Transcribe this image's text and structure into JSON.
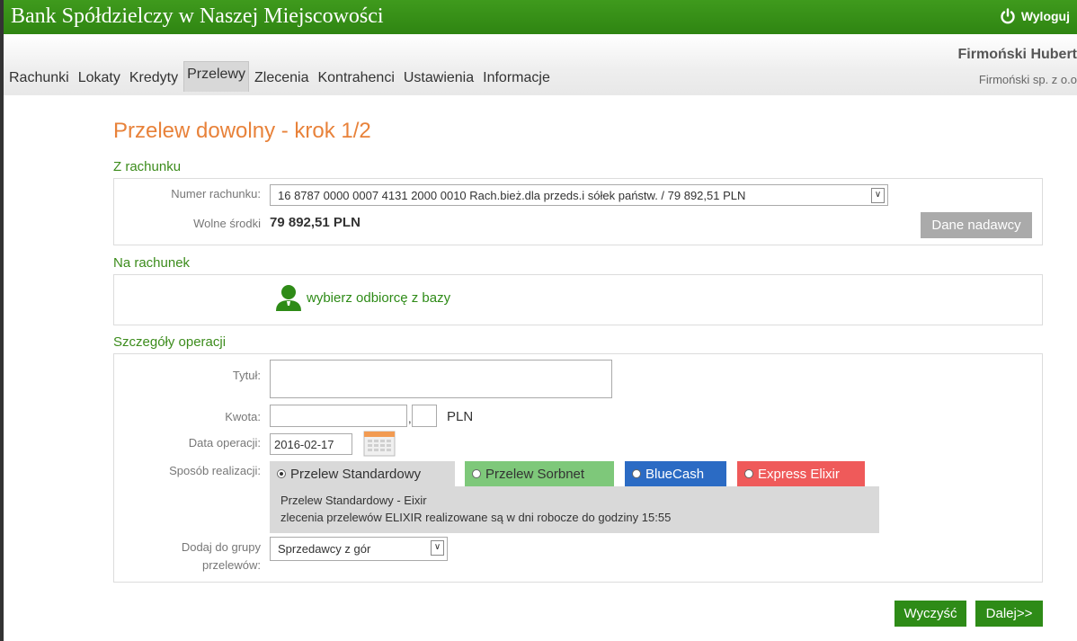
{
  "header": {
    "bank_name": "Bank Spółdzielczy w Naszej Miejscowości",
    "logout_label": "Wyloguj",
    "user_name": "Firmoński Hubert",
    "company": "Firmoński sp. z o.o"
  },
  "nav": {
    "tabs": [
      "Rachunki",
      "Lokaty",
      "Kredyty",
      "Przelewy",
      "Zlecenia",
      "Kontrahenci",
      "Ustawienia",
      "Informacje"
    ],
    "active": "Przelewy"
  },
  "page": {
    "title": "Przelew dowolny - krok 1/2"
  },
  "from_account": {
    "section_label": "Z rachunku",
    "account_label": "Numer rachunku:",
    "account_value": "16 8787 0000 0007 4131 2000 0010 Rach.bież.dla przeds.i sółek państw. / 79 892,51 PLN",
    "funds_label": "Wolne środki",
    "funds_value": "79 892,51 PLN",
    "sender_button": "Dane nadawcy"
  },
  "to_account": {
    "section_label": "Na rachunek",
    "choose_recipient": "wybierz odbiorcę z bazy"
  },
  "details": {
    "section_label": "Szczegóły operacji",
    "title_label": "Tytuł:",
    "title_value": "",
    "amount_label": "Kwota:",
    "amount_whole": "",
    "amount_cents": "",
    "currency": "PLN",
    "date_label": "Data operacji:",
    "date_value": "2016-02-17",
    "method_label": "Sposób realizacji:",
    "methods": [
      "Przelew Standardowy",
      "Przelew Sorbnet",
      "BlueCash",
      "Express Elixir"
    ],
    "selected_method": "Przelew Standardowy",
    "method_info_title": "Przelew Standardowy - Eixir",
    "method_info_text": "zlecenia przelewów ELIXIR realizowane są w dni robocze do godziny 15:55",
    "group_label_1": "Dodaj do grupy",
    "group_label_2": "przelewów:",
    "group_value": "Sprzedawcy z gór"
  },
  "actions": {
    "clear": "Wyczyść",
    "next": "Dalej>>"
  },
  "colors": {
    "brand_green": "#2f8512",
    "title_orange": "#e8823a",
    "sorbnet_green": "#7ec87a",
    "bluecash_blue": "#2b6bc4",
    "express_red": "#ef5a5a"
  }
}
